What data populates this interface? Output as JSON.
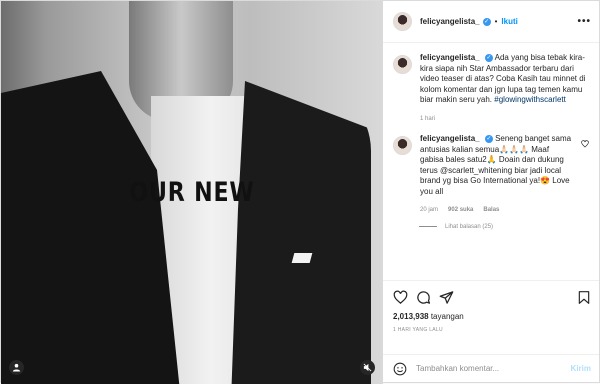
{
  "header": {
    "username": "felicyangelista_",
    "dot": "•",
    "follow_label": "Ikuti",
    "more_label": "•••"
  },
  "media": {
    "overlay_text": "OUR NEW"
  },
  "comments": [
    {
      "username": "felicyangelista_",
      "text_before": "Ada yang bisa tebak kira-kira siapa nih Star Ambassador terbaru dari video teaser di atas? Coba Kasih tau minnet di kolom komentar dan jgn lupa tag temen kamu biar makin seru yah.",
      "hashtag": "#glowingwithscarlett",
      "time": "1 hari"
    },
    {
      "username": "felicyangelista_",
      "text": "Seneng banget sama antusias kalian semua🙏🏻🙏🏻🙏🏻 Maaf gabisa bales satu2🙏 Doain dan dukung terus @scarlett_whitening biar jadi local brand yg bisa Go International ya!😍 Love you all",
      "time": "20 jam",
      "likes": "902 suka",
      "reply": "Balas",
      "view_replies": "Lihat balasan (25)"
    }
  ],
  "stats": {
    "views_count": "2,013,938",
    "views_label": "tayangan",
    "posted": "1 HARI YANG LALU"
  },
  "add_comment": {
    "placeholder": "Tambahkan komentar...",
    "post_label": "Kirim"
  },
  "colors": {
    "accent": "#0095f6",
    "verified": "#3897f0",
    "post_disabled": "#b2dffc",
    "muted": "#8e8e8e"
  },
  "icons": [
    "user-tag-icon",
    "mute-icon",
    "heart-icon",
    "comment-icon",
    "share-icon",
    "bookmark-icon",
    "emoji-icon",
    "verified-icon",
    "more-icon"
  ]
}
